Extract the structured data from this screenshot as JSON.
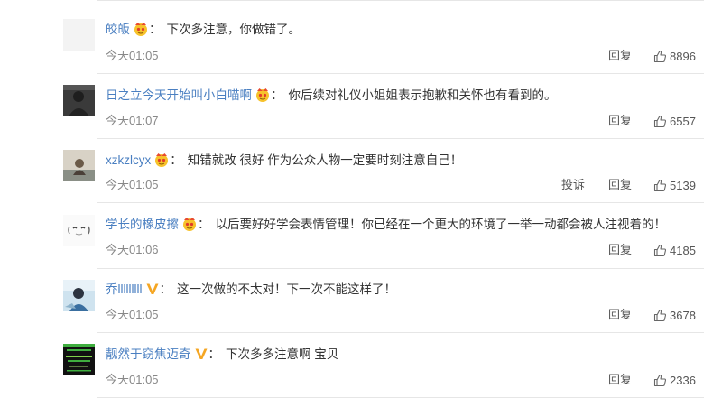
{
  "comments": [
    {
      "user": "皎皈",
      "badge": "crown-emoji",
      "text": "下次多注意，你做错了。",
      "time": "今天01:05",
      "actions": [
        "回复"
      ],
      "likes": "8896"
    },
    {
      "user": "日之立今天开始叫小白喵啊",
      "badge": "crown-emoji",
      "text": "你后续对礼仪小姐姐表示抱歉和关怀也有看到的。",
      "time": "今天01:07",
      "actions": [
        "回复"
      ],
      "likes": "6557"
    },
    {
      "user": "xzkzlcyx",
      "badge": "crown-emoji",
      "text": "知错就改 很好 作为公众人物一定要时刻注意自己！",
      "time": "今天01:05",
      "actions": [
        "投诉",
        "回复"
      ],
      "likes": "5139"
    },
    {
      "user": "学长的橡皮擦",
      "badge": "crown-emoji",
      "text": "以后要好好学会表情管理！你已经在一个更大的环境了一举一动都会被人注视着的！",
      "time": "今天01:06",
      "actions": [
        "回复"
      ],
      "likes": "4185"
    },
    {
      "user": "乔lllllllll",
      "badge": "verified-v",
      "text": "这一次做的不太对！下一次不能这样了！",
      "time": "今天01:05",
      "actions": [
        "回复"
      ],
      "likes": "3678"
    },
    {
      "user": "靓然于窃焦迈奇",
      "badge": "verified-v",
      "text": "下次多多注意啊 宝贝",
      "time": "今天01:05",
      "actions": [
        "回复"
      ],
      "likes": "2336"
    }
  ],
  "colors": {
    "username": "#4a7fc1",
    "verified": "#f5a623",
    "text": "#333333",
    "meta": "#888888"
  }
}
